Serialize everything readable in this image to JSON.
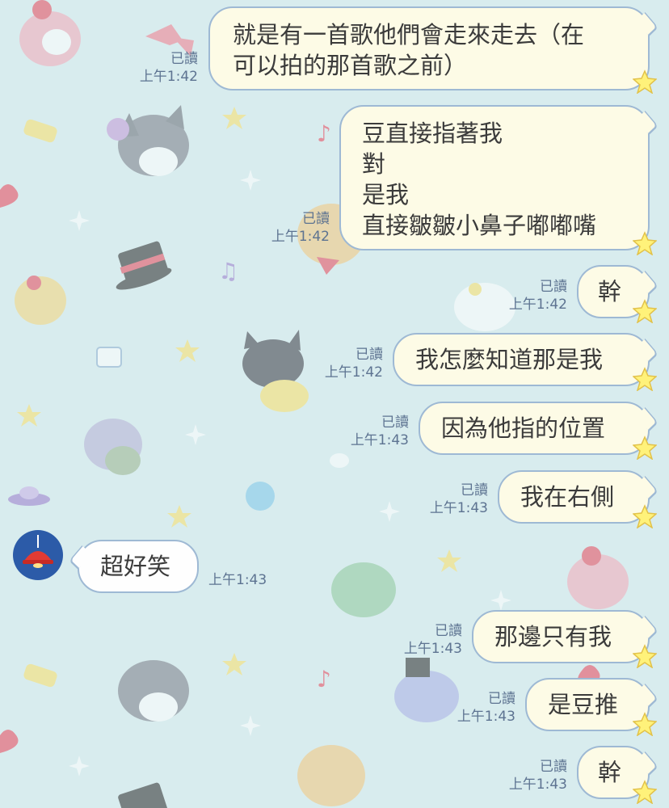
{
  "messages": [
    {
      "text": "就是有一首歌他們會走來走去（在\n可以拍的那首歌之前）",
      "read": "已讀",
      "time": "上午1:42"
    },
    {
      "text": "豆直接指著我\n對\n是我\n直接皺皺小鼻子嘟嘟嘴",
      "read": "已讀",
      "time": "上午1:42"
    },
    {
      "text": "幹",
      "read": "已讀",
      "time": "上午1:42"
    },
    {
      "text": "我怎麼知道那是我",
      "read": "已讀",
      "time": "上午1:42"
    },
    {
      "text": "因為他指的位置",
      "read": "已讀",
      "time": "上午1:43"
    },
    {
      "text": "我在右側",
      "read": "已讀",
      "time": "上午1:43"
    },
    {
      "text": "超好笑",
      "time": "上午1:43"
    },
    {
      "text": "那邊只有我",
      "read": "已讀",
      "time": "上午1:43"
    },
    {
      "text": "是豆推",
      "read": "已讀",
      "time": "上午1:43"
    },
    {
      "text": "幹",
      "read": "已讀",
      "time": "上午1:43"
    }
  ],
  "colors": {
    "background": "#d8ecee",
    "bubble_fill": "#fdfbe6",
    "bubble_border": "#9eb9d4",
    "meta_text": "#5d7391",
    "avatar": "#2c5ba8",
    "star": "#fff27a"
  },
  "icons": {
    "avatar": "red-lamp-icon",
    "bubble_decoration": "star-icon",
    "wallpaper": "sticker-wallpaper"
  }
}
